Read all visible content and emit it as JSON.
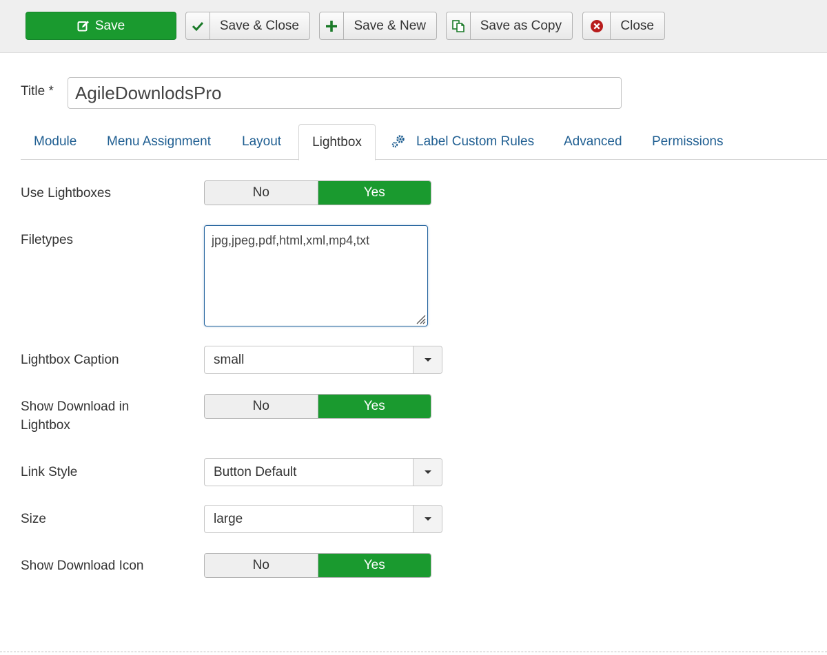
{
  "toolbar": {
    "save": "Save",
    "save_close": "Save & Close",
    "save_new": "Save & New",
    "save_copy": "Save as Copy",
    "close": "Close"
  },
  "title_field": {
    "label": "Title *",
    "value": "AgileDownlodsPro"
  },
  "tabs": [
    {
      "label": "Module"
    },
    {
      "label": "Menu Assignment"
    },
    {
      "label": "Layout"
    },
    {
      "label": "Lightbox"
    },
    {
      "label": "Label Custom Rules"
    },
    {
      "label": "Advanced"
    },
    {
      "label": "Permissions"
    }
  ],
  "active_tab": "Lightbox",
  "form": {
    "use_lightboxes": {
      "label": "Use Lightboxes",
      "no": "No",
      "yes": "Yes",
      "value": "Yes"
    },
    "filetypes": {
      "label": "Filetypes",
      "value": "jpg,jpeg,pdf,html,xml,mp4,txt"
    },
    "lightbox_caption": {
      "label": "Lightbox Caption",
      "value": "small"
    },
    "show_download": {
      "label_line1": "Show Download in",
      "label_line2": "Lightbox",
      "no": "No",
      "yes": "Yes",
      "value": "Yes"
    },
    "link_style": {
      "label": "Link Style",
      "value": "Button Default"
    },
    "size": {
      "label": "Size",
      "value": "large"
    },
    "show_download_icon": {
      "label": "Show Download Icon",
      "no": "No",
      "yes": "Yes",
      "value": "Yes"
    }
  },
  "colors": {
    "success": "#1a9a2f",
    "link": "#205f92",
    "danger": "#b81c1c"
  }
}
